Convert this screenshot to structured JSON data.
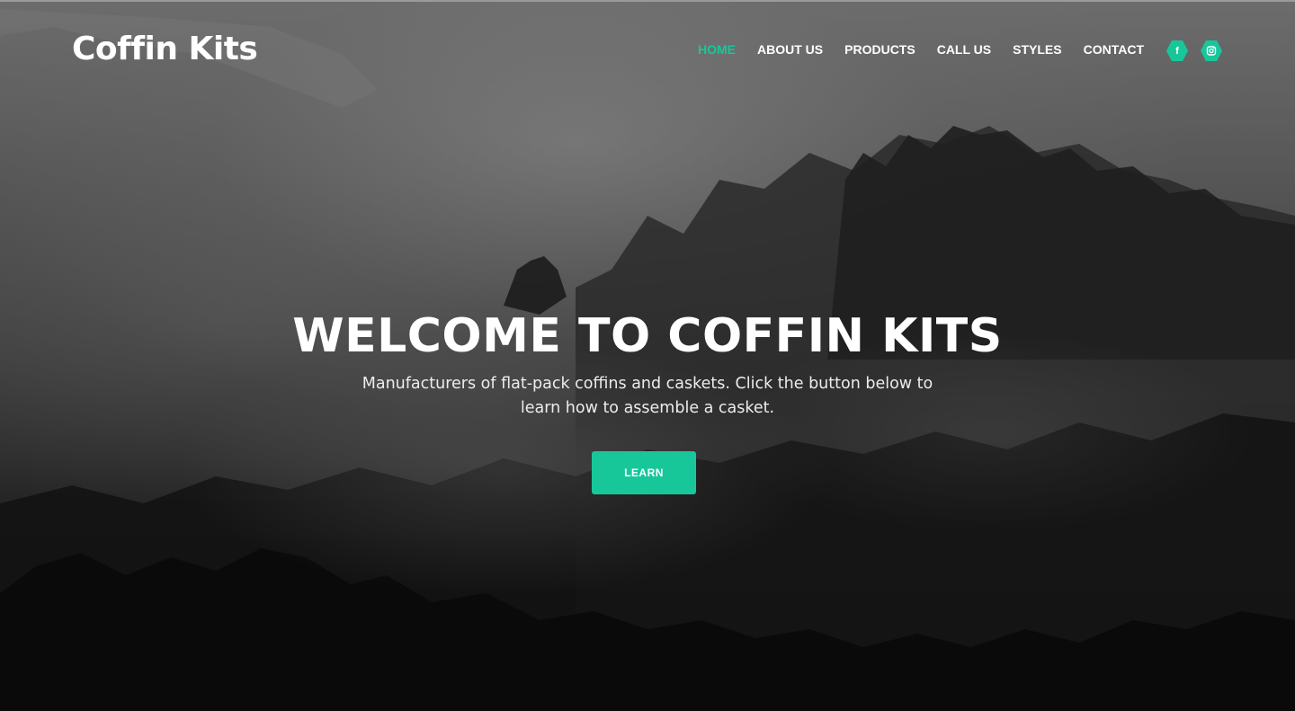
{
  "brand": {
    "name": "Coffin Kits"
  },
  "nav": {
    "items": [
      {
        "label": "HOME",
        "active": true
      },
      {
        "label": "ABOUT US",
        "active": false
      },
      {
        "label": "PRODUCTS",
        "active": false
      },
      {
        "label": "CALL US",
        "active": false
      },
      {
        "label": "STYLES",
        "active": false
      },
      {
        "label": "CONTACT",
        "active": false
      }
    ]
  },
  "social": {
    "facebook": {
      "icon": "facebook-icon",
      "glyph": "f"
    },
    "instagram": {
      "icon": "instagram-icon"
    }
  },
  "hero": {
    "headline": "WELCOME TO COFFIN KITS",
    "subtitle": "Manufacturers of flat-pack coffins and caskets. Click the button below to learn how to assemble a casket.",
    "button_label": "LEARN"
  },
  "colors": {
    "accent": "#17c79a",
    "text": "#ffffff"
  }
}
